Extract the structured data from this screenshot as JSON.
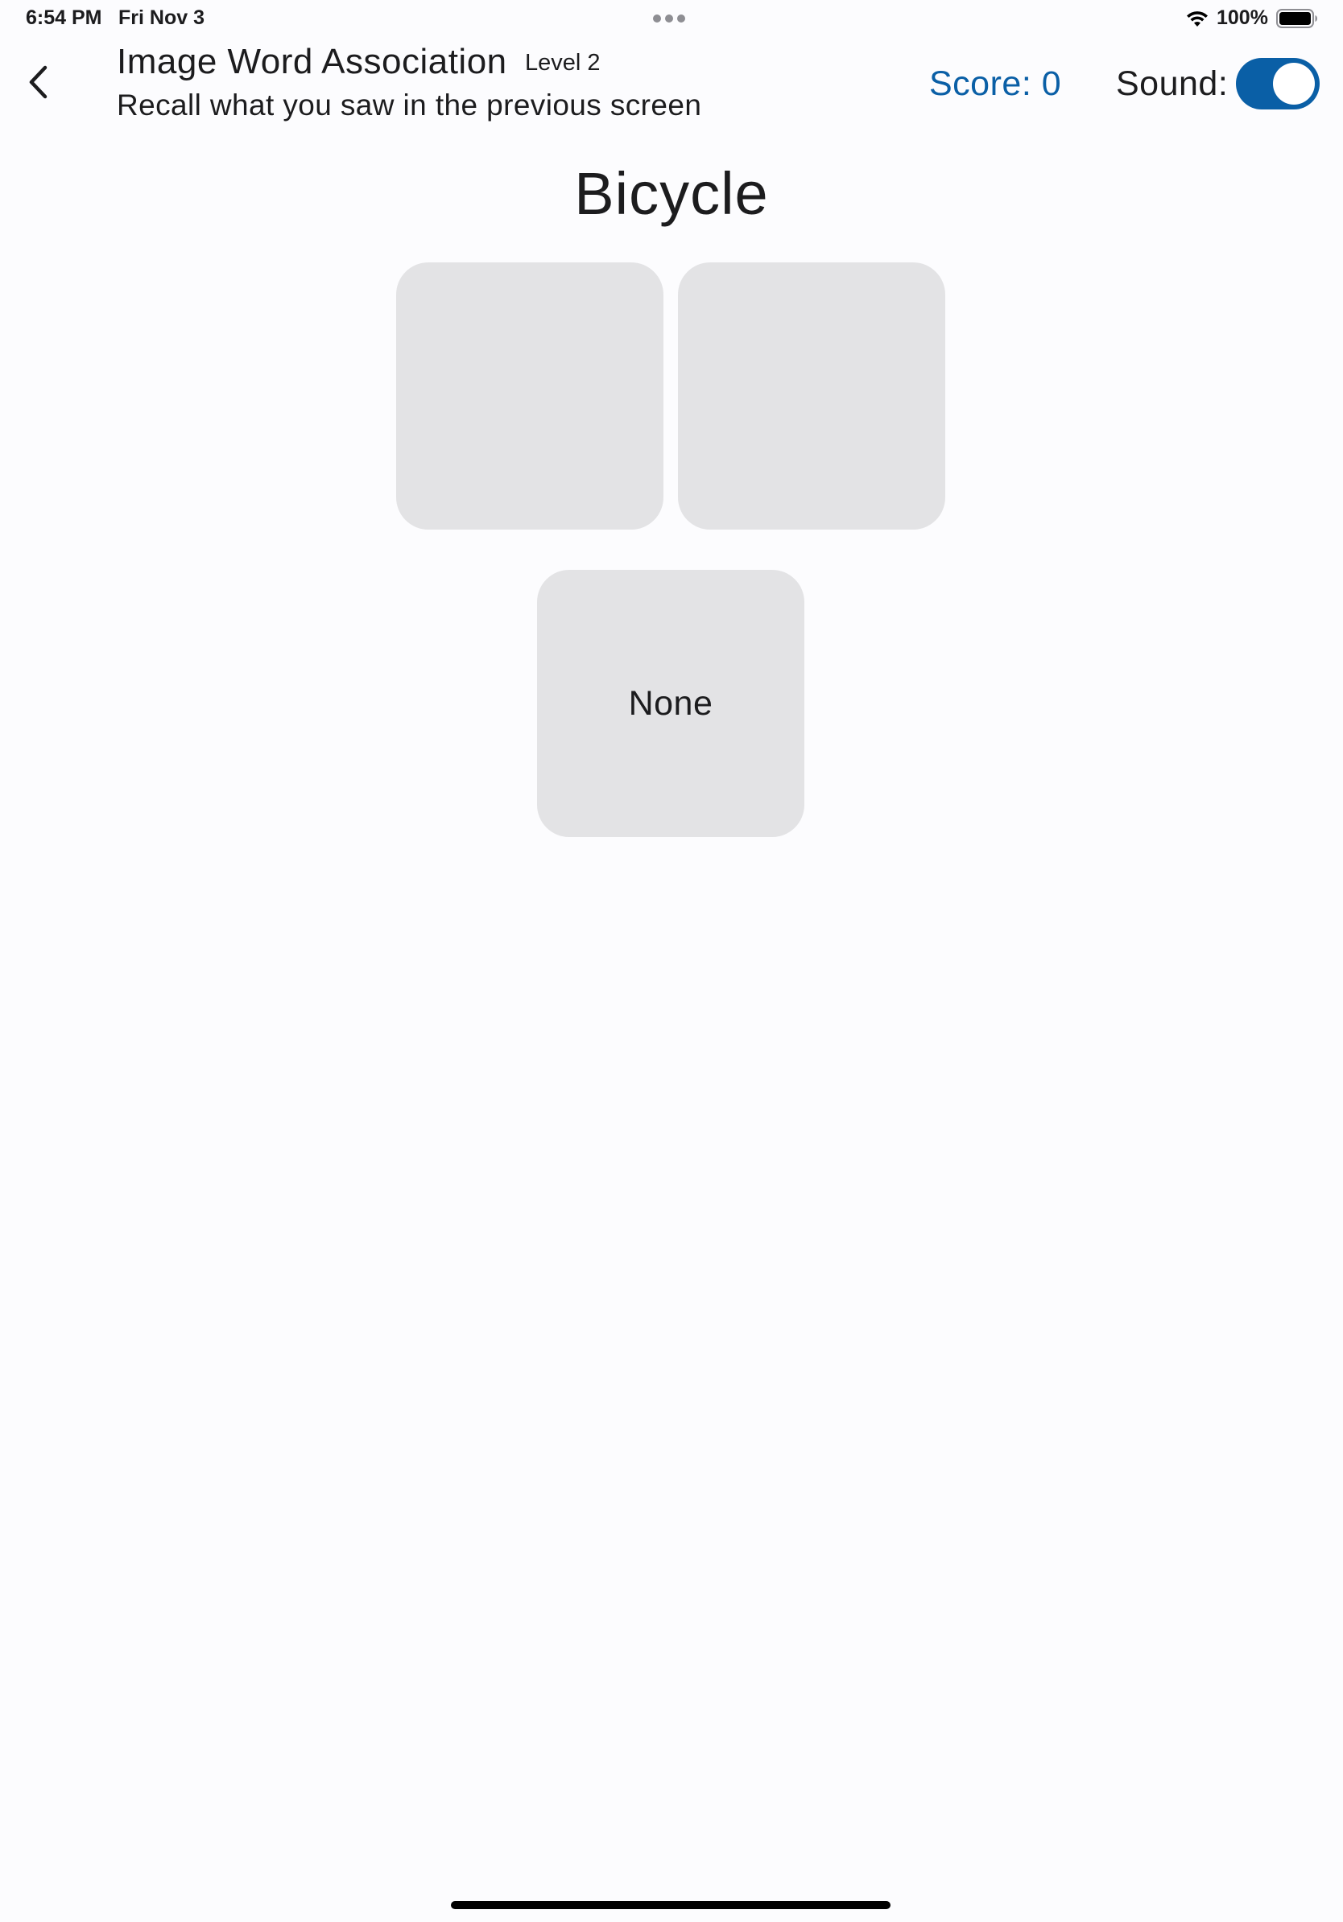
{
  "status_bar": {
    "time": "6:54 PM",
    "date": "Fri Nov 3",
    "battery": "100%"
  },
  "header": {
    "title": "Image Word Association",
    "level": "Level 2",
    "subtitle": "Recall what you saw in the previous screen",
    "score": "Score: 0",
    "sound_label": "Sound:",
    "sound_on": true
  },
  "game": {
    "prompt_word": "Bicycle",
    "none_label": "None"
  },
  "colors": {
    "accent": "#0a5fa6",
    "tile": "#e3e3e5",
    "background": "#fcfcfe"
  },
  "icons": {
    "back": "chevron-left-icon",
    "wifi": "wifi-icon",
    "battery": "battery-icon",
    "multitask": "ellipsis-icon"
  }
}
